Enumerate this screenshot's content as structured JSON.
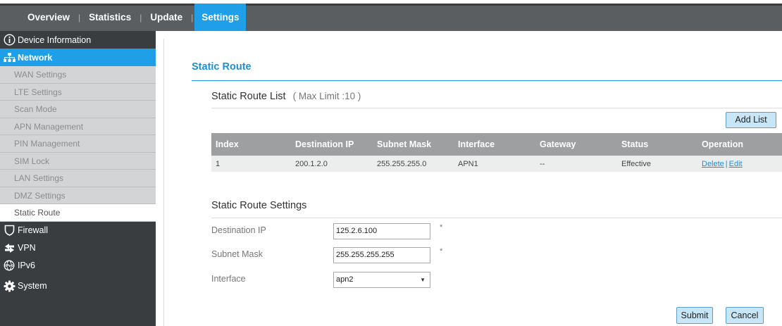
{
  "nav": {
    "tabs": [
      {
        "label": "Overview"
      },
      {
        "label": "Statistics"
      },
      {
        "label": "Update"
      },
      {
        "label": "Settings"
      }
    ]
  },
  "sidebar": {
    "device_info": "Device Information",
    "network": "Network",
    "network_items": [
      "WAN Settings",
      "LTE Settings",
      "Scan Mode",
      "APN Management",
      "PIN Management",
      "SIM Lock",
      "LAN Settings",
      "DMZ Settings",
      "Static Route"
    ],
    "firewall": "Firewall",
    "vpn": "VPN",
    "ipv6": "IPv6",
    "system": "System"
  },
  "page": {
    "title": "Static Route",
    "list_title": "Static Route List",
    "list_note": "( Max Limit :10 )",
    "add_button": "Add List",
    "table": {
      "headers": [
        "Index",
        "Destination IP",
        "Subnet Mask",
        "Interface",
        "Gateway",
        "Status",
        "Operation"
      ],
      "rows": [
        {
          "index": "1",
          "dest_ip": "200.1.2.0",
          "mask": "255.255.255.0",
          "iface": "APN1",
          "gateway": "--",
          "status": "Effective",
          "delete": "Delete",
          "sep": "|",
          "edit": "Edit"
        }
      ]
    },
    "settings_title": "Static Route Settings",
    "fields": {
      "dest_label": "Destination IP",
      "dest_value": "125.2.6.100",
      "mask_label": "Subnet Mask",
      "mask_value": "255.255.255.255",
      "iface_label": "Interface",
      "iface_value": "apn2",
      "required_mark": "*"
    },
    "submit": "Submit",
    "cancel": "Cancel"
  },
  "colors": {
    "accent": "#1e9fe8",
    "nav_bg": "#5b5e61",
    "sidebar_bg": "#3a3d40",
    "table_header": "#9d9fa1"
  }
}
